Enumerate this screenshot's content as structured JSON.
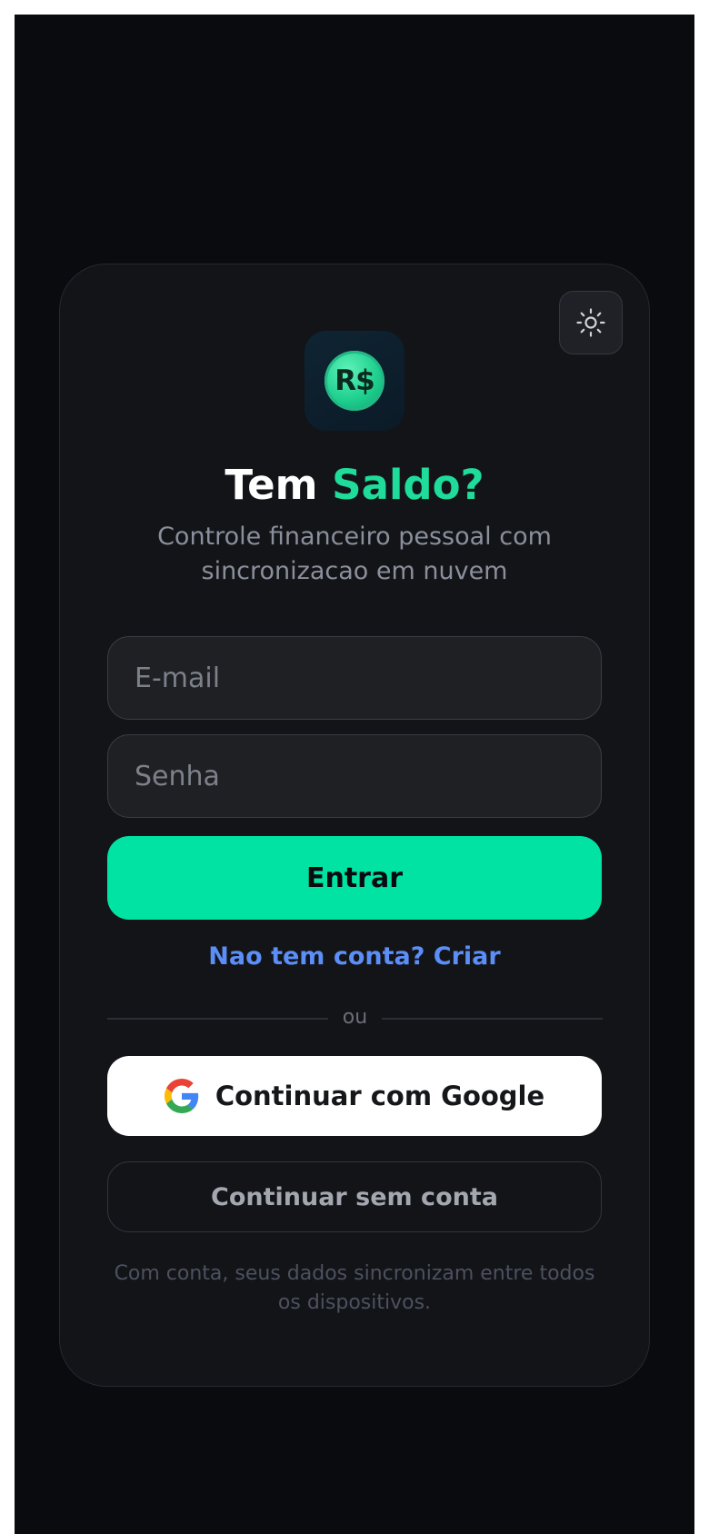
{
  "theme": {
    "background": "#0a0b0f",
    "card": "#131418",
    "accent": "#00e3a3",
    "title_accent": "#1fdc9b",
    "link": "#5b8ef7"
  },
  "header": {
    "theme_toggle_icon": "sun-icon",
    "logo_text": "R$",
    "title_part1": "Tem ",
    "title_part2": "Saldo?",
    "subtitle_line1": "Controle financeiro pessoal com",
    "subtitle_line2": "sincronizacao em nuvem"
  },
  "form": {
    "email_placeholder": "E-mail",
    "email_value": "",
    "password_placeholder": "Senha",
    "password_value": "",
    "submit_label": "Entrar",
    "signup_link": "Nao tem conta? Criar"
  },
  "divider": {
    "text": "ou"
  },
  "alt_auth": {
    "google_icon": "google-icon",
    "google_label": "Continuar com Google",
    "guest_label": "Continuar sem conta"
  },
  "footer": {
    "note_line1": "Com conta, seus dados sincronizam entre todos",
    "note_line2": "os dispositivos."
  }
}
